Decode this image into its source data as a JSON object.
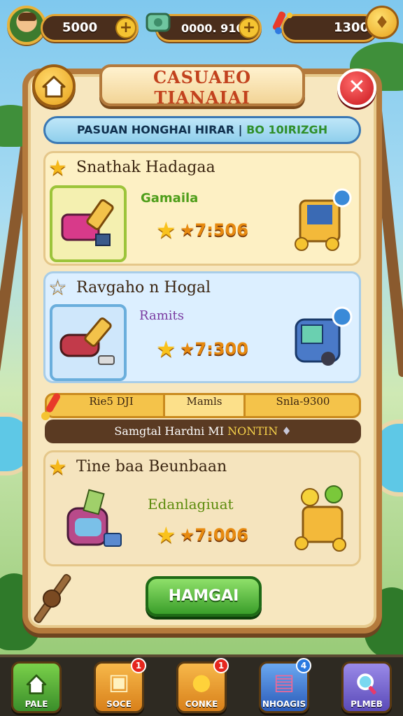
{
  "top_bar": {
    "coins": "5000",
    "gems": "0000. 9100",
    "energy": "1300",
    "plus_symbol": "+"
  },
  "panel": {
    "title": "CASUAEO TIANAIAI",
    "close_symbol": "✕",
    "subheader_main": "PASUAN HONGHAI HIRAR",
    "subheader_divider": "|",
    "subheader_highlight": "BO 10IRIZGH"
  },
  "offers": [
    {
      "title": "Snathak Hadagaa",
      "sublabel": "Gamaila",
      "price": "7:506",
      "sublabel_color": "#4e9e1a"
    },
    {
      "title": "Ravgaho n Hogal",
      "sublabel": "Ramits",
      "price": "7:300",
      "sublabel_color": "#7a3aa0"
    },
    {
      "title": "Tine baa Beunbaan",
      "sublabel": "Edanlagiuat",
      "price": "7:006",
      "sublabel_color": "#5a8a0a"
    }
  ],
  "tabs": [
    "Rie5 DJI",
    "Mamls",
    "Snla-9300"
  ],
  "notice": {
    "text": "Samgtal Hardni MI",
    "highlight": "NONTIN"
  },
  "buy_button": "HAMGAI",
  "bottom_nav": [
    {
      "label": "PALE",
      "icon": "home-icon",
      "badge": ""
    },
    {
      "label": "SOCE",
      "icon": "chest-icon",
      "badge": "1"
    },
    {
      "label": "CONKE",
      "icon": "orb-icon",
      "badge": "1"
    },
    {
      "label": "NHOAGIS",
      "icon": "book-icon",
      "badge": "4"
    },
    {
      "label": "PLMEB",
      "icon": "search-icon",
      "badge": ""
    }
  ],
  "colors": {
    "accent_gold": "#f5c431",
    "frame_brown": "#b47a3c",
    "close_red": "#c8161c",
    "buy_green": "#3a9e2a"
  }
}
